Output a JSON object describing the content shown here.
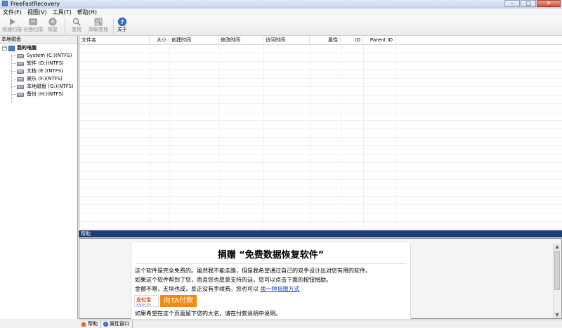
{
  "window": {
    "title": "FreeFastRecovery",
    "buttons": [
      "–",
      "□",
      "✕"
    ]
  },
  "menu": [
    "文件(F)",
    "视图(V)",
    "工具(T)",
    "帮助(H)"
  ],
  "toolbar": {
    "buttons": [
      {
        "label": "快速扫描",
        "icon": "play-icon",
        "enabled": false
      },
      {
        "label": "全面扫描",
        "icon": "disk-scan-icon",
        "enabled": false
      },
      {
        "label": "恢复",
        "icon": "recover-icon",
        "enabled": false
      },
      {
        "label": "查找",
        "icon": "search-icon",
        "enabled": false
      },
      {
        "label": "高级查找",
        "icon": "advanced-search-icon",
        "enabled": false
      },
      {
        "label": "关于",
        "icon": "help-icon",
        "enabled": true
      }
    ]
  },
  "left_pane": {
    "title": "本地磁盘",
    "root": {
      "label": "我的电脑",
      "toggle": "−"
    },
    "drives": [
      "System (C:)(NTFS)",
      "软件 (D:)(NTFS)",
      "文档 (E:)(NTFS)",
      "娱乐 (F:)(NTFS)",
      "本地磁盘 (G:)(NTFS)",
      "备份 (H:)(NTFS)"
    ]
  },
  "file_list": {
    "columns": [
      "文件名",
      "大小",
      "创建时间",
      "修改时间",
      "访问时间",
      "属性",
      "ID",
      "Parent ID"
    ]
  },
  "help_panel": {
    "title": "帮助",
    "doc_title": "捐赠 “免费数据恢复软件”",
    "lines": [
      "这个软件是完全免费的。虽然我不能走路，但是我希望通过自己的双手设计出对您有用的软件。",
      "如果这个软件帮到了您，而且您也愿意支持的话，您可以点击下面的按钮捐助。",
      "金额不限，五块也成，反正没有手续费。您也可以"
    ],
    "link_text": "换一种捐赠方式",
    "alipay_logo": "支付宝",
    "alipay_sub": "alipay.com",
    "pay_button": "向TA付款",
    "footer_line": "如果希望在这个页面留下您的大名，请在付款说明中说明。"
  },
  "status_tabs": [
    "帮助",
    "属性窗口"
  ],
  "colors": {
    "help_title_bg": "#1d3f79",
    "pay_button": "#f08a14",
    "link": "#1a4ec2"
  }
}
